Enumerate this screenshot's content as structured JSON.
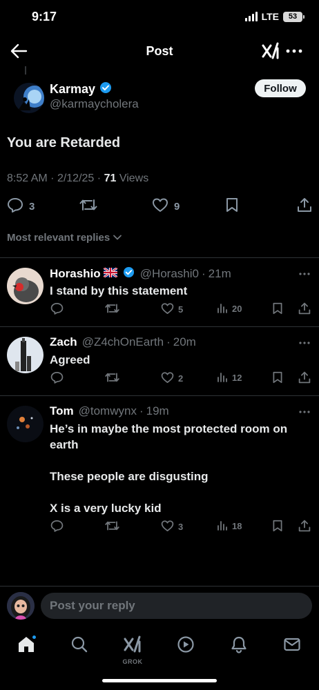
{
  "status_bar": {
    "time": "9:17",
    "network": "LTE",
    "battery": "53",
    "icons": [
      "signal-icon",
      "battery-icon"
    ]
  },
  "nav": {
    "title": "Post",
    "icons": [
      "back-arrow-icon",
      "grok-icon",
      "more-icon"
    ]
  },
  "main_post": {
    "author_name": "Karmay",
    "verified": true,
    "handle": "@karmaycholera",
    "follow_label": "Follow",
    "text": "You are Retarded",
    "time": "8:52 AM",
    "date": "2/12/25",
    "views_count": "71",
    "views_label": "Views",
    "actions": {
      "replies": "3",
      "reposts": "",
      "likes": "9"
    }
  },
  "sort_label": "Most relevant replies",
  "replies": [
    {
      "name": "Horashio",
      "flag": "uk-flag-icon",
      "verified": true,
      "handle": "@Horashi0",
      "time": "21m",
      "text": "I stand by this statement",
      "likes": "5",
      "views": "20"
    },
    {
      "name": "Zach",
      "verified": false,
      "handle": "@Z4chOnEarth",
      "time": "20m",
      "text": "Agreed",
      "likes": "2",
      "views": "12"
    },
    {
      "name": "Tom",
      "verified": false,
      "handle": "@tomwynx",
      "time": "19m",
      "text": "He’s in maybe the most protected room on earth\n\nThese people are disgusting\n\nX is a very lucky kid",
      "likes": "3",
      "views": "18"
    }
  ],
  "composer": {
    "placeholder": "Post your reply"
  },
  "tab_bar": {
    "grok_label": "GROK",
    "icons": [
      "home-icon",
      "search-icon",
      "grok-tab-icon",
      "video-icon",
      "notifications-icon",
      "messages-icon"
    ]
  },
  "colors": {
    "background": "#000000",
    "verified_blue": "#1d9bf0",
    "text_primary": "#e7e9ea",
    "text_secondary": "#71767b",
    "divider": "#2f3336"
  }
}
